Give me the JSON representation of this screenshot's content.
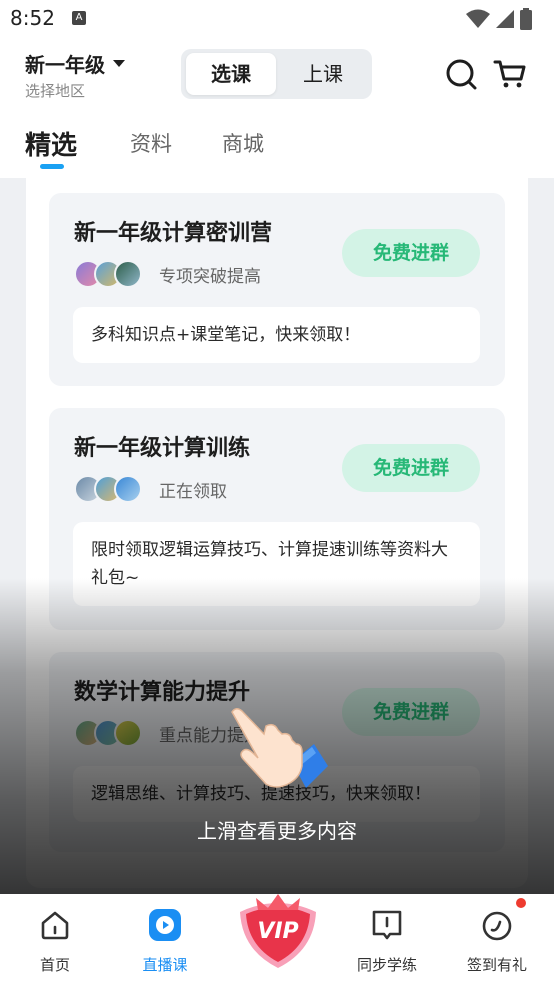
{
  "status_bar": {
    "time": "8:52",
    "notification_icon": "A"
  },
  "header": {
    "grade": "新一年级",
    "region": "选择地区",
    "mode_tabs": [
      "选课",
      "上课"
    ],
    "active_mode": 0
  },
  "top_tabs": [
    "精选",
    "资料",
    "商城"
  ],
  "groups": [
    {
      "title": "新一年级计算密训营",
      "subtitle": "专项突破提高",
      "button": "免费进群",
      "description": "多科知识点+课堂笔记，快来领取！"
    },
    {
      "title": "新一年级计算训练",
      "subtitle": "正在领取",
      "button": "免费进群",
      "description": "限时领取逻辑运算技巧、计算提速训练等资料大礼包~"
    },
    {
      "title": "数学计算能力提升",
      "subtitle": "重点能力提升",
      "button": "免费进群",
      "description": "逻辑思维、计算技巧、提速技巧，快来领取！"
    }
  ],
  "overlay": {
    "swipe_hint": "上滑查看更多内容"
  },
  "bottom_nav": [
    {
      "label": "首页",
      "icon": "home-icon"
    },
    {
      "label": "直播课",
      "icon": "live-play-icon"
    },
    {
      "label": "VIP",
      "icon": "vip-badge-icon"
    },
    {
      "label": "同步学练",
      "icon": "book-icon"
    },
    {
      "label": "签到有礼",
      "icon": "checkin-icon"
    }
  ],
  "colors": {
    "accent_blue": "#1a8ef3",
    "join_green": "#27b877",
    "join_bg": "#d3f3e6",
    "vip_red": "#e8344a"
  }
}
